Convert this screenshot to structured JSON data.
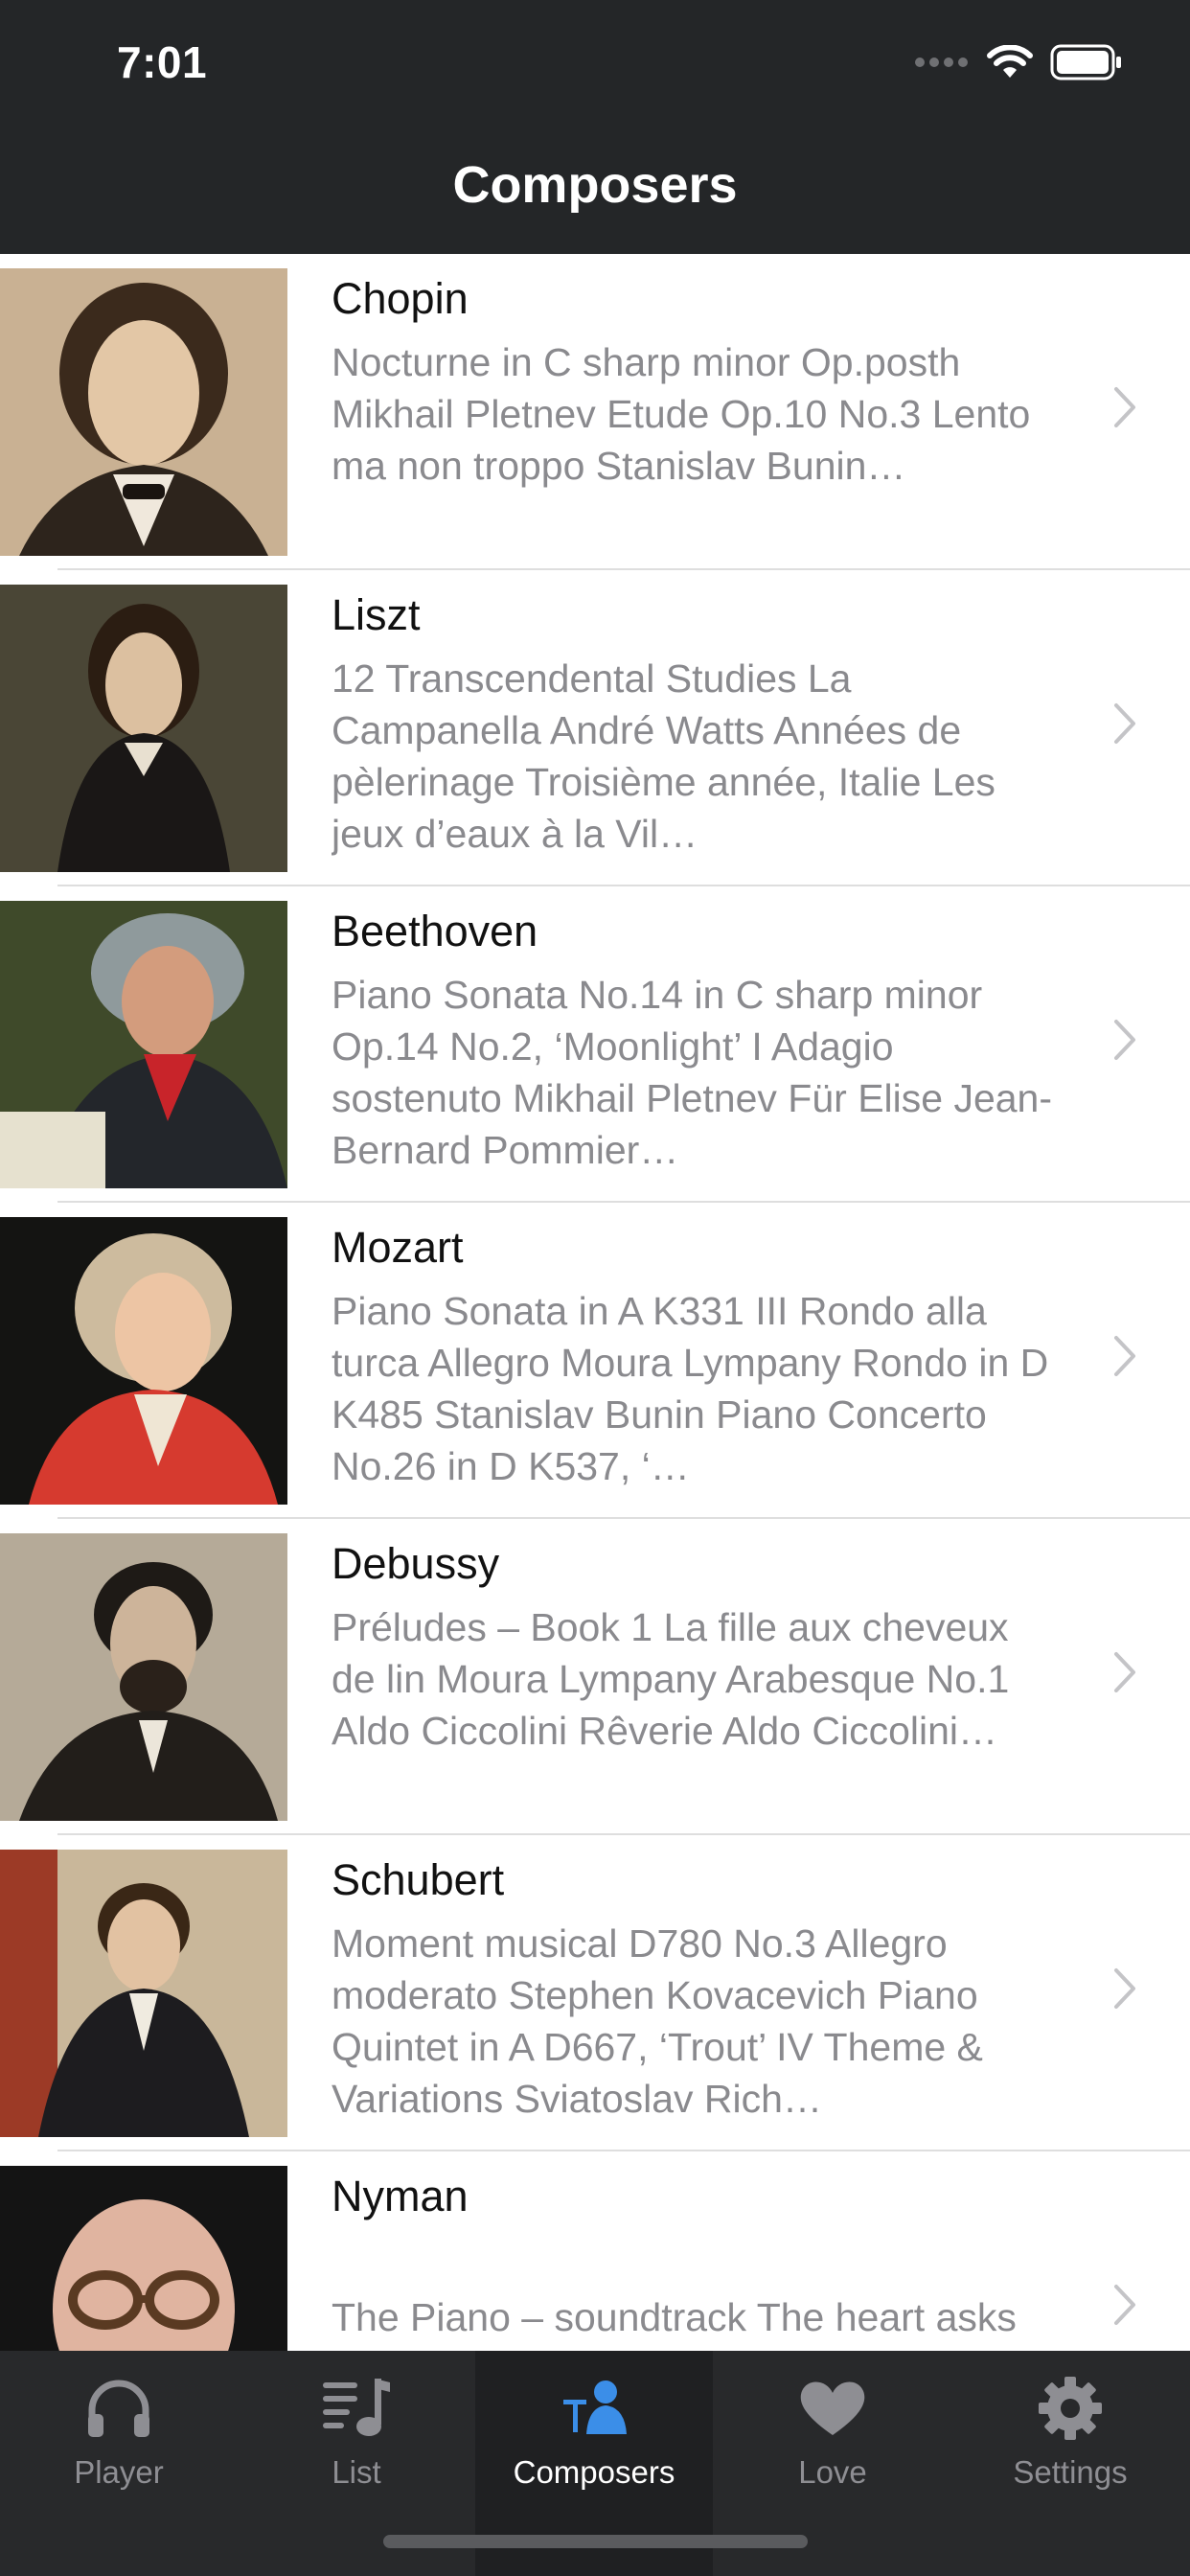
{
  "status_bar": {
    "time": "7:01"
  },
  "nav": {
    "title": "Composers"
  },
  "composers": [
    {
      "name": "Chopin",
      "subtitle": "Nocturne in C sharp minor Op.posth Mikhail Pletnev\nEtude Op.10 No.3 Lento ma non troppo Stanislav Bunin…"
    },
    {
      "name": "Liszt",
      "subtitle": "12 Transcendental Studies La Campanella André Watts\nAnnées de pèlerinage Troisième année, Italie Les jeux d’eaux à la Vil…"
    },
    {
      "name": "Beethoven",
      "subtitle": "Piano Sonata No.14 in C sharp minor Op.14 No.2, ‘Moonlight’ I Adagio sostenuto Mikhail Pletnev\nFür Elise Jean-Bernard Pommier…"
    },
    {
      "name": "Mozart",
      "subtitle": "Piano Sonata in A K331 III Rondo alla turca Allegro Moura Lympany\nRondo in D K485 Stanislav Bunin\nPiano Concerto No.26 in D K537, ‘…"
    },
    {
      "name": "Debussy",
      "subtitle": "Préludes – Book 1 La fille aux cheveux de lin Moura Lympany\nArabesque No.1 Aldo Ciccolini\nRêverie Aldo Ciccolini…"
    },
    {
      "name": "Schubert",
      "subtitle": "Moment musical D780 No.3 Allegro moderato Stephen Kovacevich\nPiano Quintet in A D667, ‘Trout’ IV Theme & Variations Sviatoslav Rich…"
    },
    {
      "name": "Nyman",
      "subtitle": "The Piano – soundtrack The heart asks pleasure first Michael Nyman"
    }
  ],
  "tabs": [
    {
      "label": "Player",
      "icon": "headphones-icon"
    },
    {
      "label": "List",
      "icon": "music-list-icon"
    },
    {
      "label": "Composers",
      "icon": "composers-icon",
      "active": true
    },
    {
      "label": "Love",
      "icon": "heart-icon"
    },
    {
      "label": "Settings",
      "icon": "gear-icon"
    }
  ],
  "colors": {
    "bar_background": "#242628",
    "tab_active": "#3b8ee8",
    "tab_inactive": "#8e8e93"
  }
}
